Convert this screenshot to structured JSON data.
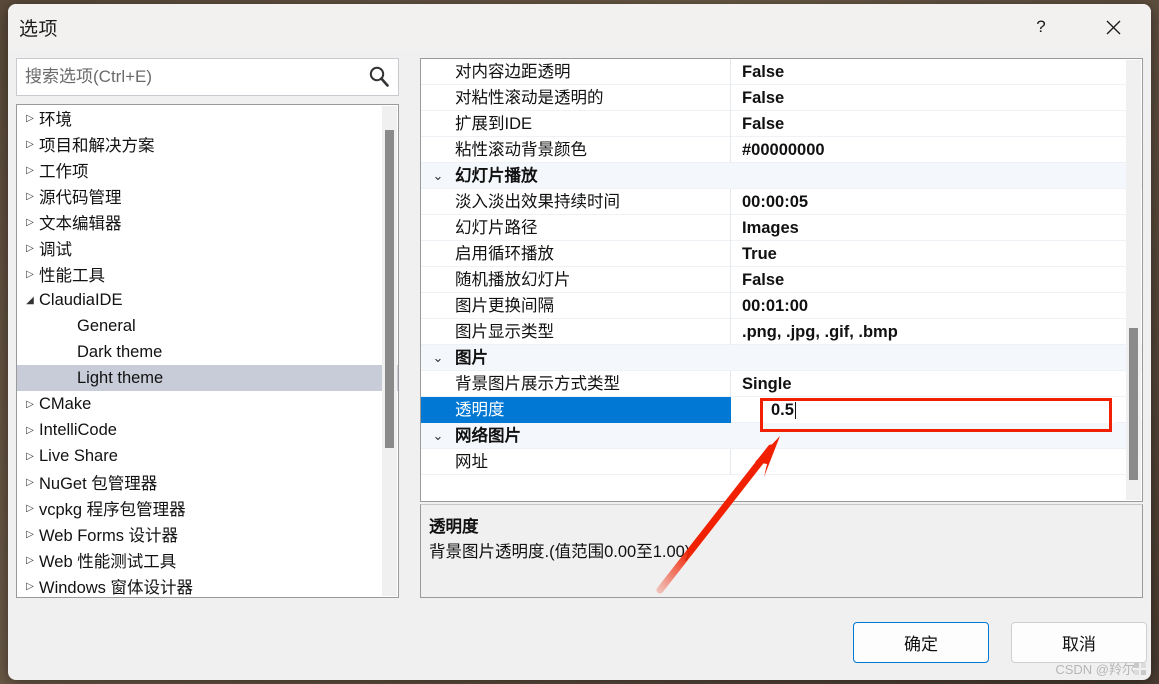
{
  "window": {
    "title": "选项",
    "help_label": "?",
    "close_label": "✕",
    "accent_color": "#0078d4",
    "annotation_color": "#f02000"
  },
  "search": {
    "placeholder": "搜索选项(Ctrl+E)",
    "value": "",
    "icon": "search-icon"
  },
  "tree": {
    "items": [
      {
        "label": "环境",
        "level": 0,
        "twisty": "▷",
        "selected": false
      },
      {
        "label": "项目和解决方案",
        "level": 0,
        "twisty": "▷",
        "selected": false
      },
      {
        "label": "工作项",
        "level": 0,
        "twisty": "▷",
        "selected": false
      },
      {
        "label": "源代码管理",
        "level": 0,
        "twisty": "▷",
        "selected": false
      },
      {
        "label": "文本编辑器",
        "level": 0,
        "twisty": "▷",
        "selected": false
      },
      {
        "label": "调试",
        "level": 0,
        "twisty": "▷",
        "selected": false
      },
      {
        "label": "性能工具",
        "level": 0,
        "twisty": "▷",
        "selected": false
      },
      {
        "label": "ClaudiaIDE",
        "level": 0,
        "twisty": "◢",
        "selected": false
      },
      {
        "label": "General",
        "level": 1,
        "twisty": "",
        "selected": false
      },
      {
        "label": "Dark theme",
        "level": 1,
        "twisty": "",
        "selected": false
      },
      {
        "label": "Light theme",
        "level": 1,
        "twisty": "",
        "selected": true
      },
      {
        "label": "CMake",
        "level": 0,
        "twisty": "▷",
        "selected": false
      },
      {
        "label": "IntelliCode",
        "level": 0,
        "twisty": "▷",
        "selected": false
      },
      {
        "label": "Live Share",
        "level": 0,
        "twisty": "▷",
        "selected": false
      },
      {
        "label": "NuGet 包管理器",
        "level": 0,
        "twisty": "▷",
        "selected": false
      },
      {
        "label": "vcpkg 程序包管理器",
        "level": 0,
        "twisty": "▷",
        "selected": false
      },
      {
        "label": "Web Forms 设计器",
        "level": 0,
        "twisty": "▷",
        "selected": false
      },
      {
        "label": "Web 性能测试工具",
        "level": 0,
        "twisty": "▷",
        "selected": false
      },
      {
        "label": "Windows 窗体设计器",
        "level": 0,
        "twisty": "▷",
        "selected": false
      }
    ]
  },
  "grid": {
    "rows": [
      {
        "kind": "prop",
        "name": "对内容边距透明",
        "value": "False",
        "selected": false
      },
      {
        "kind": "prop",
        "name": "对粘性滚动是透明的",
        "value": "False",
        "selected": false
      },
      {
        "kind": "prop",
        "name": "扩展到IDE",
        "value": "False",
        "selected": false
      },
      {
        "kind": "prop",
        "name": "粘性滚动背景颜色",
        "value": "#00000000",
        "selected": false
      },
      {
        "kind": "category",
        "name": "幻灯片播放",
        "value": "",
        "chevron": "⌄",
        "selected": false
      },
      {
        "kind": "prop",
        "name": "淡入淡出效果持续时间",
        "value": "00:00:05",
        "selected": false
      },
      {
        "kind": "prop",
        "name": "幻灯片路径",
        "value": "Images",
        "selected": false
      },
      {
        "kind": "prop",
        "name": "启用循环播放",
        "value": "True",
        "selected": false
      },
      {
        "kind": "prop",
        "name": "随机播放幻灯片",
        "value": "False",
        "selected": false
      },
      {
        "kind": "prop",
        "name": "图片更换间隔",
        "value": "00:01:00",
        "selected": false
      },
      {
        "kind": "prop",
        "name": "图片显示类型",
        "value": ".png, .jpg, .gif, .bmp",
        "selected": false
      },
      {
        "kind": "category",
        "name": "图片",
        "value": "",
        "chevron": "⌄",
        "selected": false
      },
      {
        "kind": "prop",
        "name": "背景图片展示方式类型",
        "value": "Single",
        "selected": false
      },
      {
        "kind": "prop",
        "name": "透明度",
        "value": "0.5",
        "selected": true,
        "editing": true
      },
      {
        "kind": "category",
        "name": "网络图片",
        "value": "",
        "chevron": "⌄",
        "selected": false
      },
      {
        "kind": "prop",
        "name": "网址",
        "value": "",
        "selected": false
      }
    ]
  },
  "description": {
    "title": "透明度",
    "text": "背景图片透明度.(值范围0.00至1.00)"
  },
  "buttons": {
    "ok": "确定",
    "cancel": "取消"
  },
  "watermark": {
    "text": "CSDN @羚尔"
  }
}
